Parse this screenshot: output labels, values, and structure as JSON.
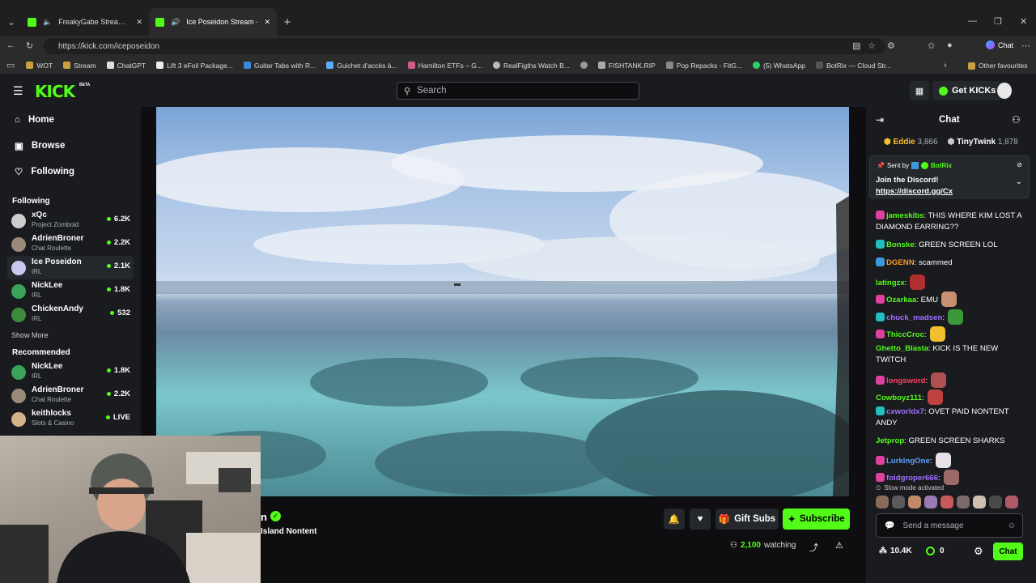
{
  "browser": {
    "tabs": [
      {
        "title": "FreakyGabe Stream - Watch Li"
      },
      {
        "title": "Ice Poseidon Stream - Watch"
      }
    ],
    "url": "https://kick.com/iceposeidon",
    "chat_button": "Chat",
    "bookmarks": [
      "WOT",
      "Stream",
      "ChatGPT",
      "Lift 3 eFoil Package...",
      "Guitar Tabs with R...",
      "Guichet d'accès à...",
      "Hamilton ETFs – G...",
      "RealFigths Watch B...",
      "FISHTANK.RIP",
      "Pop Repacks - FitG...",
      "(5) WhatsApp",
      "BotRix — Cloud Str..."
    ],
    "other_favourites": "Other favourites"
  },
  "header": {
    "logo": "KICK",
    "beta": "BETA",
    "search_placeholder": "Search",
    "get_kicks": "Get KICKs"
  },
  "sidebar": {
    "nav": [
      {
        "label": "Home",
        "icon": "home-icon"
      },
      {
        "label": "Browse",
        "icon": "browse-icon"
      },
      {
        "label": "Following",
        "icon": "heart-icon"
      }
    ],
    "following_title": "Following",
    "following": [
      {
        "name": "xQc",
        "category": "Project Zomboid",
        "viewers": "6.2K",
        "color": "#cccccc"
      },
      {
        "name": "AdrienBroner",
        "category": "Chat Roulette",
        "viewers": "2.2K",
        "color": "#9a8a7a"
      },
      {
        "name": "Ice Poseidon",
        "category": "IRL",
        "viewers": "2.1K",
        "color": "#c9c9f0"
      },
      {
        "name": "NickLee",
        "category": "IRL",
        "viewers": "1.8K",
        "color": "#3aa35a"
      },
      {
        "name": "ChickenAndy",
        "category": "IRL",
        "viewers": "532",
        "color": "#3d8a3d"
      }
    ],
    "show_more": "Show More",
    "recommended_title": "Recommended",
    "recommended": [
      {
        "name": "NickLee",
        "category": "IRL",
        "viewers": "1.8K",
        "color": "#3aa35a"
      },
      {
        "name": "AdrienBroner",
        "category": "Chat Roulette",
        "viewers": "2.2K",
        "color": "#9a8a7a"
      },
      {
        "name": "keithlocks",
        "category": "Slots & Casino",
        "viewers": "LIVE",
        "color": "#d4b48a"
      }
    ]
  },
  "stream": {
    "streamer_partial": "n",
    "title_partial": "Island Nontent",
    "gift_subs": "Gift Subs",
    "subscribe": "Subscribe",
    "watching_count": "2,100",
    "watching_label": "watching"
  },
  "chat": {
    "title": "Chat",
    "top_gifters": [
      {
        "name": "Eddie",
        "count": "3,866"
      },
      {
        "name": "TinyTwink",
        "count": "1,878"
      }
    ],
    "pinned": {
      "sent_by": "Sent by",
      "sender": "BotRix",
      "line1": "Join the Discord!",
      "link": "https://discord.gg/Cx"
    },
    "messages": [
      {
        "user": "jameskibs",
        "color": "#53fc18",
        "text": ": THIS WHERE KIM LOST A DIAMOND EARRING??",
        "badge": "#e040a0"
      },
      {
        "user": "Bonske",
        "color": "#53fc18",
        "text": ": GREEN SCREEN LOL",
        "badge": "#20c0c0"
      },
      {
        "user": "DGENN",
        "color": "#ff9a2a",
        "text": ": scammed",
        "badge": "#3a9ad9"
      },
      {
        "user": "latingzx",
        "color": "#53fc18",
        "text": ":",
        "badge": ""
      },
      {
        "user": "Ozarkaa",
        "color": "#53fc18",
        "text": ": EMU",
        "badge": "#e040a0"
      },
      {
        "user": "chuck_madsen",
        "color": "#a070ff",
        "text": ":",
        "badge": "#20c0c0"
      },
      {
        "user": "ThiccCroc",
        "color": "#53fc18",
        "text": ":",
        "badge": "#e040a0"
      },
      {
        "user": "Ghetto_Blasta",
        "color": "#53fc18",
        "text": ": KICK IS THE NEW TWITCH",
        "badge": ""
      },
      {
        "user": "longsword",
        "color": "#ff4060",
        "text": ":",
        "badge": "#e040a0"
      },
      {
        "user": "Cowboyz111",
        "color": "#53fc18",
        "text": ":",
        "badge": ""
      },
      {
        "user": "cxworldx7",
        "color": "#a070ff",
        "text": ": OVET PAID NONTENT ANDY",
        "badge": "#20c0c0"
      },
      {
        "user": "Jetprop",
        "color": "#53fc18",
        "text": ": GREEN SCREEN SHARKS",
        "badge": ""
      },
      {
        "user": "LurkingOne",
        "color": "#5aa0ff",
        "text": ":",
        "badge": "#e040a0"
      },
      {
        "user": "foidgroper666",
        "color": "#a070ff",
        "text": ":",
        "badge": "#e040a0"
      }
    ],
    "slow_mode": "Slow mode activated",
    "input_placeholder": "Send a message",
    "kicks_count": "10.4K",
    "points": "0",
    "chat_button": "Chat"
  },
  "colors": {
    "accent": "#53fc18",
    "bg": "#0e0e10",
    "panel": "#191b1f"
  }
}
